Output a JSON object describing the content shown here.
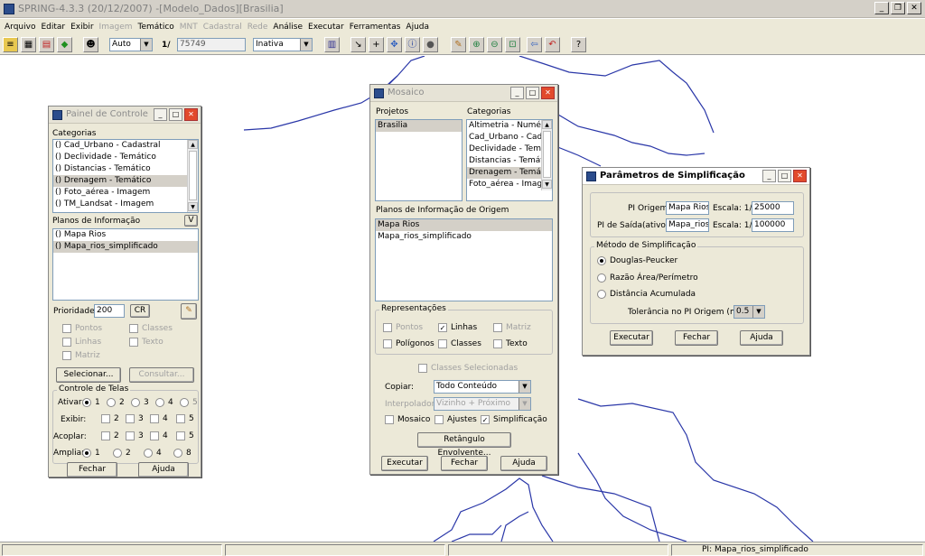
{
  "app": {
    "title": "SPRING-4.3.3 (20/12/2007) -[Modelo_Dados][Brasilia]",
    "min": "_",
    "restore": "❐",
    "close": "✕"
  },
  "menu": [
    {
      "label": "Arquivo",
      "en": true
    },
    {
      "label": "Editar",
      "en": true
    },
    {
      "label": "Exibir",
      "en": true
    },
    {
      "label": "Imagem",
      "en": false
    },
    {
      "label": "Temático",
      "en": true
    },
    {
      "label": "MNT",
      "en": false
    },
    {
      "label": "Cadastral",
      "en": false
    },
    {
      "label": "Rede",
      "en": false
    },
    {
      "label": "Análise",
      "en": true
    },
    {
      "label": "Executar",
      "en": true
    },
    {
      "label": "Ferramentas",
      "en": true
    },
    {
      "label": "Ajuda",
      "en": true
    }
  ],
  "toolbar": {
    "scale_mode": "Auto",
    "scale_prefix": "1/",
    "scale_value": "75749",
    "status": "Inativa",
    "dd": "▼"
  },
  "status": {
    "pi": "PI: Mapa_rios_simplificado"
  },
  "painel": {
    "title": "Painel de Controle",
    "categorias_label": "Categorias",
    "categorias": [
      "() Cad_Urbano - Cadastral",
      "() Declividade - Temático",
      "() Distancias - Temático",
      "() Drenagem - Temático",
      "() Foto_aérea - Imagem",
      "() TM_Landsat - Imagem"
    ],
    "pi_label": "Planos de Informação",
    "pi_toggle": "V",
    "pis": [
      "() Mapa Rios",
      "() Mapa_rios_simplificado"
    ],
    "prioridade_label": "Prioridade:",
    "prioridade": "200",
    "cr": "CR",
    "reps": [
      "Pontos",
      "Classes",
      "Linhas",
      "Texto",
      "Matriz"
    ],
    "selecionar": "Selecionar...",
    "consultar": "Consultar...",
    "controle_label": "Controle de Telas",
    "ativar": "Ativar:",
    "exibir": "Exibir:",
    "acoplar": "Acoplar:",
    "ampliar": "Ampliar:",
    "n": [
      "1",
      "2",
      "3",
      "4",
      "5"
    ],
    "amp": [
      "1",
      "2",
      "4",
      "8"
    ],
    "fechar": "Fechar",
    "ajuda": "Ajuda"
  },
  "mosaico": {
    "title": "Mosaico",
    "projetos_label": "Projetos",
    "projetos": [
      "Brasilia"
    ],
    "categorias_label": "Categorias",
    "categorias": [
      "Altimetria - Numérico",
      "Cad_Urbano - Cadastral",
      "Declividade - Temático",
      "Distancias - Temático",
      "Drenagem - Temático",
      "Foto_aérea - Imagem"
    ],
    "pi_label": "Planos de Informação de Origem",
    "pis": [
      "Mapa Rios",
      "Mapa_rios_simplificado"
    ],
    "rep_label": "Representações",
    "reps": [
      {
        "l": "Pontos",
        "c": false,
        "d": true
      },
      {
        "l": "Linhas",
        "c": true,
        "d": false
      },
      {
        "l": "Matriz",
        "c": false,
        "d": true
      },
      {
        "l": "Polígonos",
        "c": false,
        "d": false
      },
      {
        "l": "Classes",
        "c": false,
        "d": false
      },
      {
        "l": "Texto",
        "c": false,
        "d": false
      }
    ],
    "classes_sel": "Classes Selecionadas",
    "copiar_label": "Copiar:",
    "copiar": "Todo Conteúdo",
    "interp_label": "Interpolador:",
    "interp": "Vizinho + Próximo",
    "opts": [
      {
        "l": "Mosaico",
        "c": false
      },
      {
        "l": "Ajustes",
        "c": false
      },
      {
        "l": "Simplificação",
        "c": true
      }
    ],
    "retangulo": "Retângulo Envolvente...",
    "executar": "Executar",
    "fechar": "Fechar",
    "ajuda": "Ajuda",
    "check": "✓"
  },
  "simpl": {
    "title": "Parâmetros de Simplificação",
    "pi_origem_label": "PI Origem:",
    "pi_origem": "Mapa Rios",
    "escala1_label": "Escala: 1/",
    "escala1": "25000",
    "pi_saida_label": "PI de Saída(ativo):",
    "pi_saida": "Mapa_rios_",
    "escala2_label": "Escala: 1/",
    "escala2": "100000",
    "metodo_label": "Método de Simplificação",
    "metodos": [
      "Douglas-Peucker",
      "Razão Área/Perímetro",
      "Distância Acumulada"
    ],
    "tol_label": "Tolerância no PI Origem (mm):",
    "tol": "0.5",
    "executar": "Executar",
    "fechar": "Fechar",
    "ajuda": "Ajuda"
  },
  "colors": {
    "river": "#2a37a8",
    "accent": "#2b4c8c"
  }
}
